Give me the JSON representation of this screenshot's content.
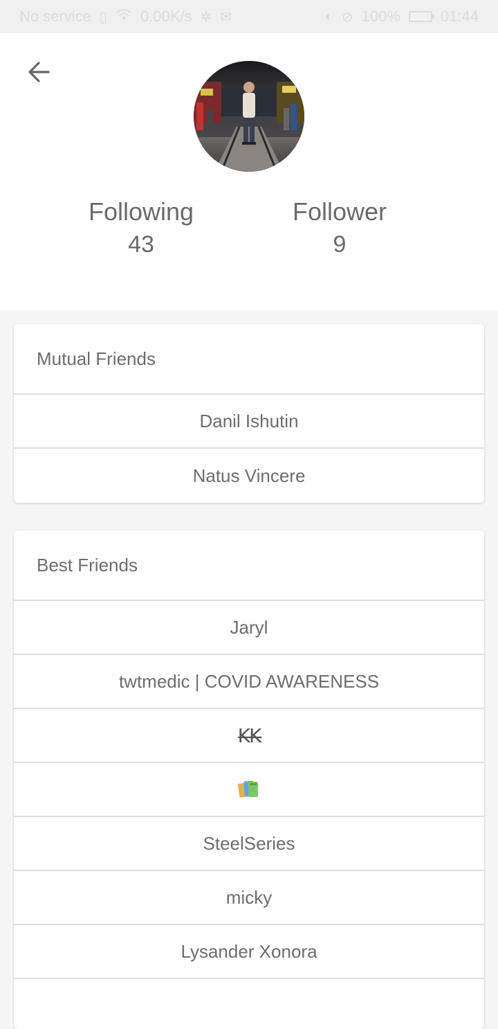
{
  "status_bar": {
    "carrier": "No service",
    "speed": "0.00K/s",
    "battery": "100%",
    "time": "01:44"
  },
  "header": {
    "back_icon": "arrow-left-icon",
    "avatar_alt": "profile-photo",
    "following_label": "Following",
    "following_count": "43",
    "follower_label": "Follower",
    "follower_count": "9"
  },
  "mutual_friends": {
    "title": "Mutual Friends",
    "items": [
      {
        "label": "Danil Ishutin"
      },
      {
        "label": "Natus Vincere"
      }
    ]
  },
  "best_friends": {
    "title": "Best Friends",
    "items": [
      {
        "label": "Jaryl"
      },
      {
        "label": "twtmedic | COVID AWARENESS"
      },
      {
        "label": "K̶K̶"
      },
      {
        "label": "books-emoji"
      },
      {
        "label": "SteelSeries"
      },
      {
        "label": "micky"
      },
      {
        "label": "Lysander Xonora"
      },
      {
        "label": ""
      }
    ]
  },
  "colors": {
    "background": "#f5f5f5",
    "card": "#ffffff",
    "text": "#6d6d6d",
    "divider": "#dedede"
  }
}
